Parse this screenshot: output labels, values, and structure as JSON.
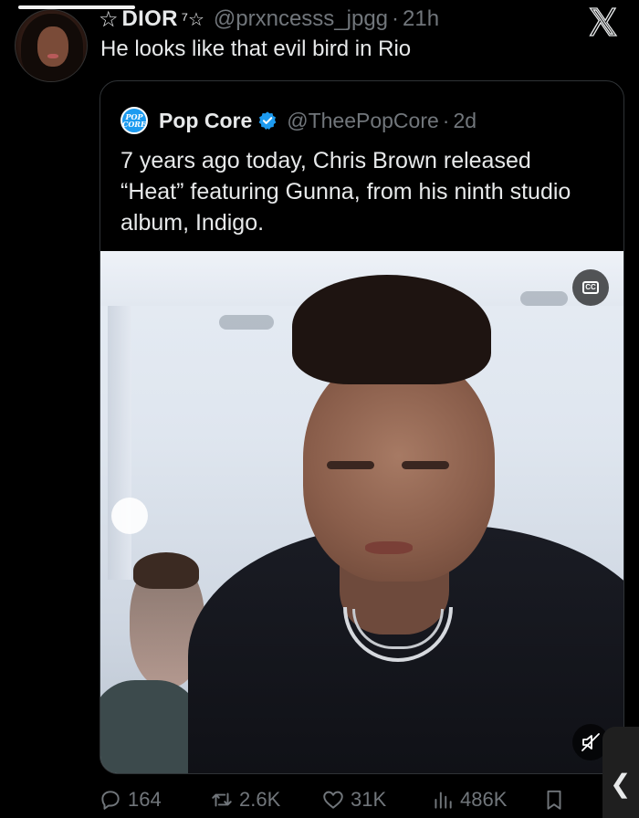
{
  "reply": {
    "star_left": "☆",
    "name": "DIOR",
    "name_mark": "⁷☆",
    "handle": "@prxncesss_jpgg",
    "separator": "·",
    "time": "21h",
    "text": "He looks like that evil bird in Rio",
    "icon": "avatar-photo"
  },
  "topbar": {
    "close_icon": "x-logo-icon"
  },
  "quote": {
    "avatar_line1": "POP",
    "avatar_line2": "CORE",
    "name": "Pop Core",
    "verified_icon": "verified-badge-icon",
    "handle": "@TheePopCore",
    "separator": "·",
    "time": "2d",
    "text": "7 years ago today, Chris Brown released “Heat” featuring Gunna, from his ninth studio album, Indigo.",
    "media": {
      "cc_label": "CC",
      "cc_icon": "closed-captions-icon",
      "mute_icon": "muted-speaker-icon"
    }
  },
  "actions": {
    "reply_count": "164",
    "repost_count": "2.6K",
    "like_count": "31K",
    "views_count": "486K",
    "reply_icon": "reply-bubble-icon",
    "repost_icon": "repost-icon",
    "like_icon": "heart-icon",
    "views_icon": "views-bars-icon",
    "bookmark_icon": "bookmark-icon"
  },
  "edge": {
    "glyph": "❮"
  },
  "colors": {
    "background": "#000000",
    "text": "#e7e9ea",
    "muted": "#71767b",
    "border": "#2f3336",
    "accent": "#1d9bf0"
  }
}
